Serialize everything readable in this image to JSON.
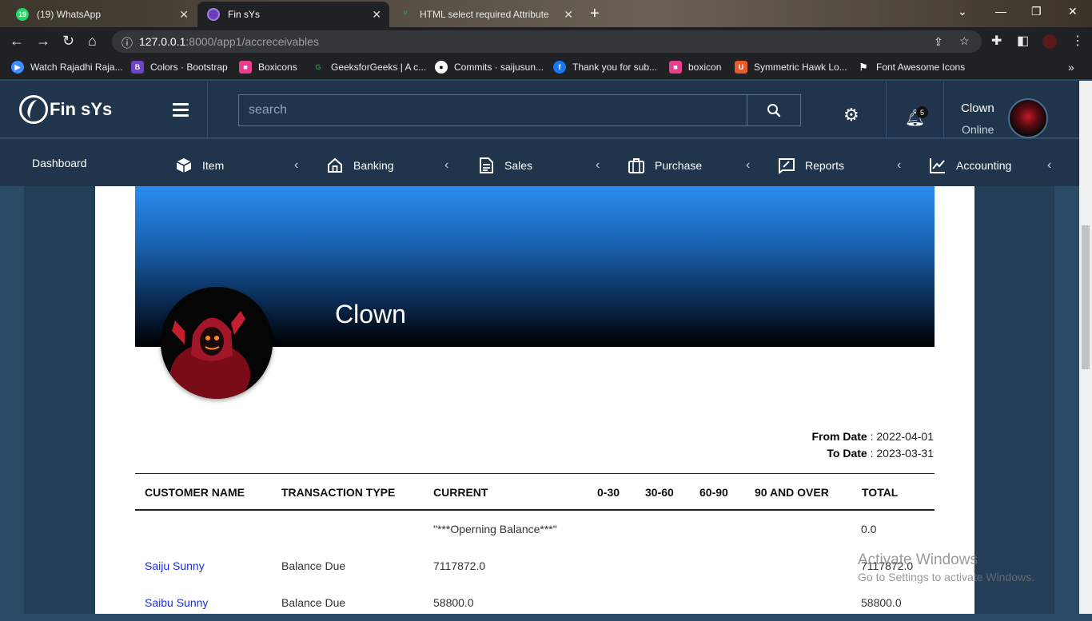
{
  "browser": {
    "tabs": [
      {
        "title": "(19) WhatsApp",
        "favicon_text": "19",
        "favicon_color": "#25d366"
      },
      {
        "title": "Fin sYs",
        "favicon_text": "",
        "favicon_color": "#6a3fb8"
      },
      {
        "title": "HTML select required Attribute",
        "favicon_text": "",
        "favicon_color": "#2f8d46"
      }
    ],
    "url_host": "127.0.0.1",
    "url_path": ":8000/app1/accreceivables",
    "bookmarks": [
      {
        "label": "Watch Rajadhi Raja...",
        "color": "#3c8dff",
        "glyph": "▶"
      },
      {
        "label": "Colors · Bootstrap",
        "color": "#6f42c1",
        "glyph": "B"
      },
      {
        "label": "Boxicons",
        "color": "#e83e8c",
        "glyph": "■"
      },
      {
        "label": "GeeksforGeeks | A c...",
        "color": "#2f8d46",
        "glyph": "G"
      },
      {
        "label": "Commits · saijusun...",
        "color": "#333333",
        "glyph": "●"
      },
      {
        "label": "Thank you for sub...",
        "color": "#1877f2",
        "glyph": "f"
      },
      {
        "label": "boxicon",
        "color": "#e83e8c",
        "glyph": "■"
      },
      {
        "label": "Symmetric Hawk Lo...",
        "color": "#e8592c",
        "glyph": "U"
      },
      {
        "label": "Font Awesome Icons",
        "color": "#333333",
        "glyph": "⚑"
      }
    ]
  },
  "app": {
    "logo_text": "Fin sYs",
    "search_placeholder": "search",
    "notification_count": "5",
    "user_name": "Clown",
    "user_status": "Online"
  },
  "nav": {
    "dashboard": "Dashboard",
    "items": [
      "Item",
      "Banking",
      "Sales",
      "Purchase",
      "Reports",
      "Accounting"
    ]
  },
  "profile": {
    "name": "Clown"
  },
  "report": {
    "from_label": "From Date",
    "from_value": "2022-04-01",
    "to_label": "To Date",
    "to_value": "2023-03-31",
    "columns": [
      "CUSTOMER NAME",
      "TRANSACTION TYPE",
      "CURRENT",
      "0-30",
      "30-60",
      "60-90",
      "90 AND OVER",
      "TOTAL"
    ],
    "rows": [
      {
        "customer": "",
        "type": "",
        "current": "\"***Operning Balance***\"",
        "total": "0.0"
      },
      {
        "customer": "Saiju Sunny",
        "type": "Balance Due",
        "current": "7117872.0",
        "total": "7117872.0"
      },
      {
        "customer": "Saibu Sunny",
        "type": "Balance Due",
        "current": "58800.0",
        "total": "58800.0"
      }
    ]
  },
  "watermark": {
    "line1": "Activate Windows",
    "line2": "Go to Settings to activate Windows."
  }
}
